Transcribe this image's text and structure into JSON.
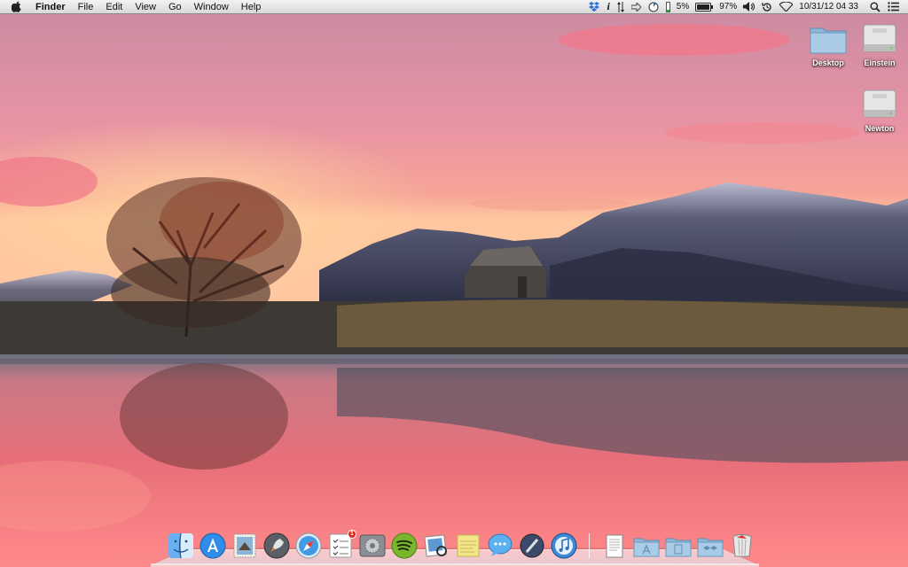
{
  "menubar": {
    "app_name": "Finder",
    "menus": [
      "File",
      "Edit",
      "View",
      "Go",
      "Window",
      "Help"
    ],
    "status": {
      "cpu_percent": "5%",
      "battery_percent": "97%",
      "datetime": "10/31/12 04 33"
    }
  },
  "desktop": {
    "icons": [
      {
        "label": "Desktop",
        "icon": "folder-icon"
      },
      {
        "label": "Einstein",
        "icon": "hard-drive-icon"
      },
      {
        "label": "Newton",
        "icon": "hard-drive-icon"
      }
    ]
  },
  "dock": {
    "apps": [
      {
        "icon": "finder-icon"
      },
      {
        "icon": "app-store-icon"
      },
      {
        "icon": "mail-stamp-icon"
      },
      {
        "icon": "launchpad-rocket-icon"
      },
      {
        "icon": "safari-icon"
      },
      {
        "icon": "reminders-icon",
        "badge": "1"
      },
      {
        "icon": "system-preferences-icon"
      },
      {
        "icon": "spotify-icon"
      },
      {
        "icon": "preview-icon"
      },
      {
        "icon": "stickies-icon"
      },
      {
        "icon": "messages-icon"
      },
      {
        "icon": "script-editor-icon"
      },
      {
        "icon": "itunes-icon"
      }
    ],
    "stacks": [
      {
        "icon": "document-stack-icon"
      },
      {
        "icon": "applications-folder-icon"
      },
      {
        "icon": "documents-folder-icon"
      },
      {
        "icon": "dropbox-folder-icon"
      },
      {
        "icon": "trash-icon"
      }
    ]
  },
  "colors": {
    "sky_top": "#d98aa0",
    "sky_glow": "#ff9c86",
    "water": "#e2707a",
    "mountain": "#3c3f5c"
  }
}
